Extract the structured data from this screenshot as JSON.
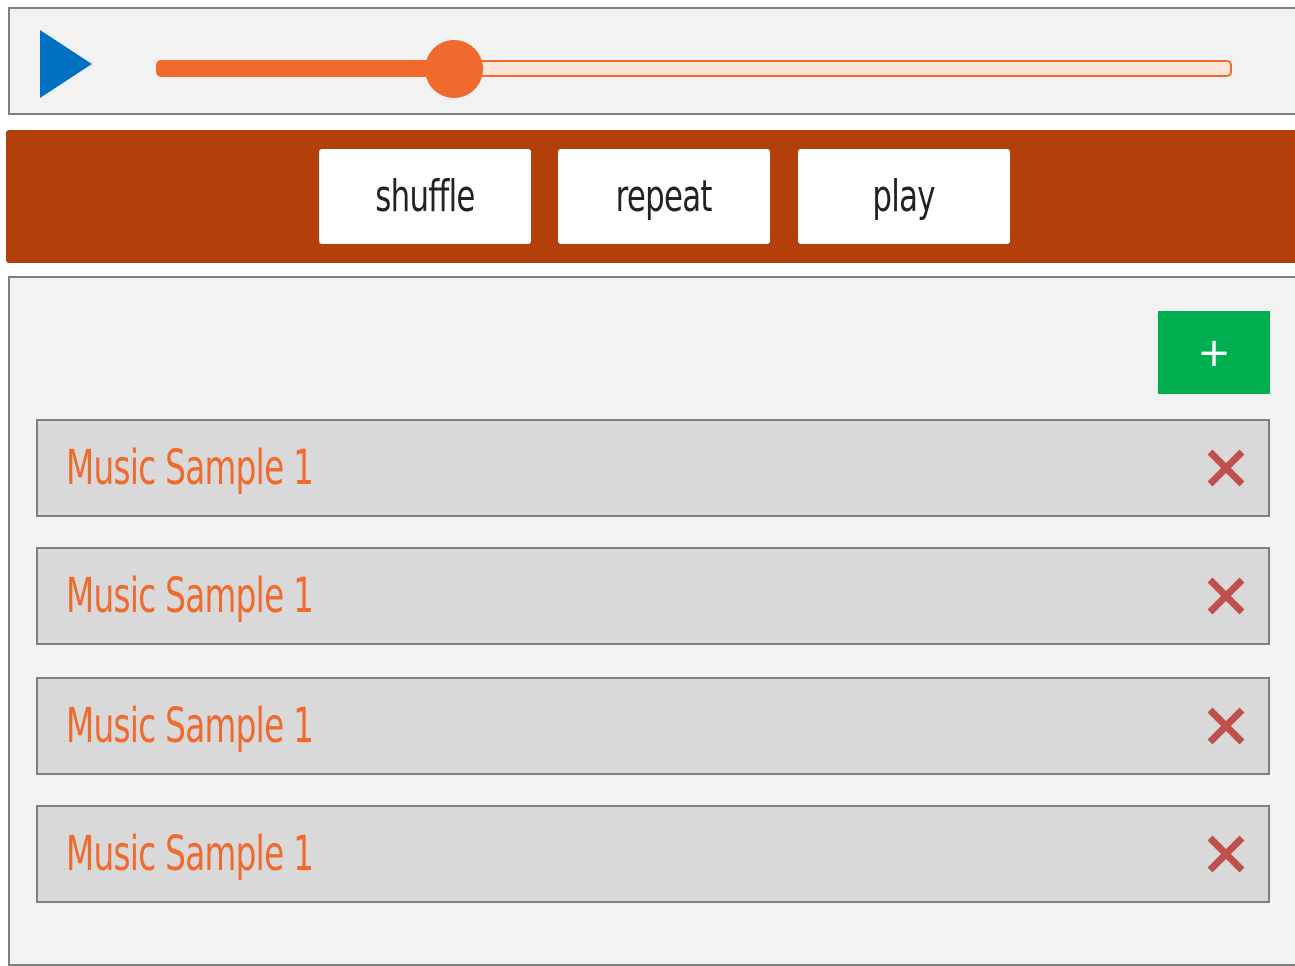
{
  "player": {
    "play_icon": "play-icon",
    "progress": 0.276,
    "colors": {
      "play": "#0070c0",
      "slider": "#f06a2d",
      "slider_track": "#fce5d6"
    }
  },
  "toolbar": {
    "background": "#b33f0b",
    "buttons": [
      {
        "label": "shuffle"
      },
      {
        "label": "repeat"
      },
      {
        "label": "play"
      }
    ]
  },
  "playlist": {
    "add_label": "+",
    "add_color": "#00b050",
    "remove_icon": "close-icon",
    "remove_color": "#c0504d",
    "items": [
      {
        "title": "Music Sample 1"
      },
      {
        "title": "Music Sample 1"
      },
      {
        "title": "Music Sample 1"
      },
      {
        "title": "Music Sample 1"
      }
    ]
  }
}
